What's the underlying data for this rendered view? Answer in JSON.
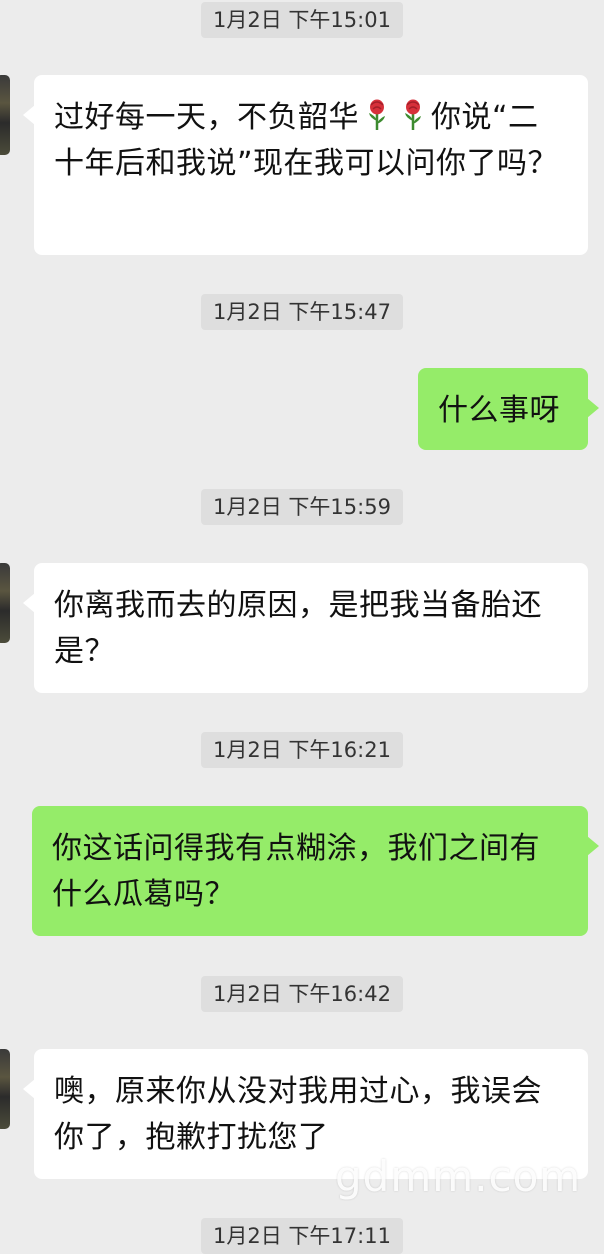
{
  "messages": [
    {
      "type": "timestamp",
      "text": "1月2日 下午15:01"
    },
    {
      "type": "incoming",
      "text_before": "过好每一天，不负韶华",
      "icon": "rose-emoji",
      "text_after": "你说“二十年后和我说”现在我可以问你了吗？"
    },
    {
      "type": "timestamp",
      "text": "1月2日 下午15:47"
    },
    {
      "type": "outgoing",
      "text": "什么事呀"
    },
    {
      "type": "timestamp",
      "text": "1月2日 下午15:59"
    },
    {
      "type": "incoming",
      "text": "你离我而去的原因，是把我当备胎还是？"
    },
    {
      "type": "timestamp",
      "text": "1月2日 下午16:21"
    },
    {
      "type": "outgoing",
      "text": "你这话问得我有点糊涂，我们之间有什么瓜葛吗？"
    },
    {
      "type": "timestamp",
      "text": "1月2日 下午16:42"
    },
    {
      "type": "incoming",
      "text": "噢，原来你从没对我用过心，我误会你了，抱歉打扰您了"
    },
    {
      "type": "timestamp",
      "text": "1月2日 下午17:11"
    }
  ],
  "watermark": "gdmm.com",
  "colors": {
    "background": "#ececec",
    "incoming_bubble": "#ffffff",
    "outgoing_bubble": "#95ec69",
    "timestamp_bg": "#dedede"
  }
}
